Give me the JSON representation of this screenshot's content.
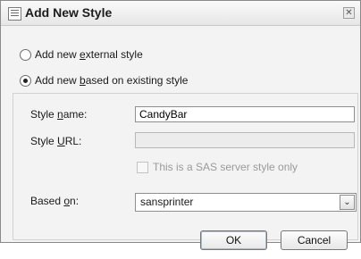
{
  "dialog": {
    "title": "Add New Style",
    "close_glyph": "✕"
  },
  "options": {
    "external": {
      "before": "Add new ",
      "accel": "e",
      "after": "xternal style",
      "checked": false
    },
    "existing": {
      "before": "Add new ",
      "accel": "b",
      "after": "ased on existing style",
      "checked": true
    }
  },
  "form": {
    "style_name": {
      "before": "Style ",
      "accel": "n",
      "after": "ame:",
      "value": "CandyBar"
    },
    "style_url": {
      "before": "Style ",
      "accel": "U",
      "after": "RL:",
      "value": ""
    },
    "sas_only": {
      "label": "This is a SAS server style only",
      "checked": false,
      "enabled": false
    },
    "based_on": {
      "before": "Based ",
      "accel": "o",
      "after": "n:",
      "value": "sansprinter"
    }
  },
  "buttons": {
    "ok": "OK",
    "cancel": "Cancel"
  },
  "icons": {
    "app": "style-list-icon",
    "close": "close-icon",
    "dropdown": "chevron-down-icon"
  }
}
